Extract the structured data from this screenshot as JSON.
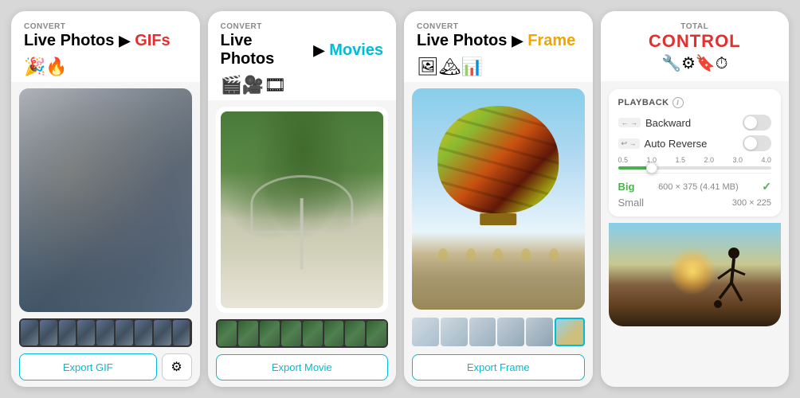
{
  "screens": [
    {
      "id": "gif-screen",
      "convert_label": "CONVERT",
      "title_live": "Live Photos",
      "title_arrow": "▶",
      "title_target": "GIFs",
      "title_target_color": "gif",
      "emojis": "🎉🔥",
      "export_button": "Export GIF",
      "has_settings": true,
      "settings_icon": "⚙"
    },
    {
      "id": "movies-screen",
      "convert_label": "CONVERT",
      "title_live": "Live Photos",
      "title_arrow": "▶",
      "title_target": "Movies",
      "title_target_color": "movies",
      "emojis": "🎬🎥🎞",
      "export_button": "Export Movie",
      "has_settings": false
    },
    {
      "id": "frame-screen",
      "convert_label": "CONVERT",
      "title_live": "Live Photos",
      "title_arrow": "▶",
      "title_target": "Frame",
      "title_target_color": "frame",
      "emojis": "🖼🏔📊",
      "export_button": "Export Frame",
      "has_settings": false
    }
  ],
  "control": {
    "total_label": "TOTAL",
    "title": "CONTROL",
    "icons": "🔧⚙🔖⏱",
    "playback": {
      "section_title": "PLAYBACK",
      "backward_label": "Backward",
      "backward_indicator": "← →",
      "auto_reverse_label": "Auto Reverse",
      "auto_reverse_indicator": "↩ →",
      "speed_labels": [
        "0.5",
        "1.0",
        "1.5",
        "2.0",
        "3.0",
        "4.0"
      ],
      "sizes": [
        {
          "name": "Big",
          "dims": "600 × 375 (4.41 MB)",
          "selected": true
        },
        {
          "name": "Small",
          "dims": "300 × 225",
          "selected": false
        }
      ]
    }
  }
}
